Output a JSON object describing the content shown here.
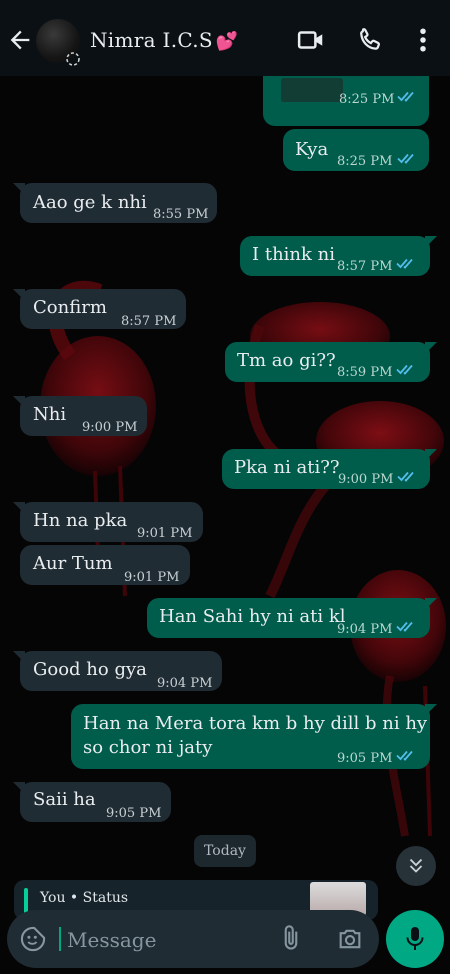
{
  "header": {
    "contact_name": "Nimra I.C.S",
    "contact_emoji": "💕",
    "icons": [
      "back-arrow-icon",
      "video-call-icon",
      "voice-call-icon",
      "more-options-icon"
    ]
  },
  "messages": [
    {
      "direction": "out",
      "text": "Kya",
      "time": "8:25 PM",
      "status": "read"
    },
    {
      "direction": "in",
      "text": "Aao ge k nhi",
      "time": "8:55 PM"
    },
    {
      "direction": "out",
      "text": "I think ni",
      "time": "8:57 PM",
      "status": "read"
    },
    {
      "direction": "in",
      "text": "Confirm",
      "time": "8:57 PM"
    },
    {
      "direction": "out",
      "text": "Tm ao gi??",
      "time": "8:59 PM",
      "status": "read"
    },
    {
      "direction": "in",
      "text": "Nhi",
      "time": "9:00 PM"
    },
    {
      "direction": "out",
      "text": "Pka ni ati??",
      "time": "9:00 PM",
      "status": "read"
    },
    {
      "direction": "in",
      "text": "Hn na pka",
      "time": "9:01 PM"
    },
    {
      "direction": "in",
      "text": "Aur Tum",
      "time": "9:01 PM"
    },
    {
      "direction": "out",
      "text": "Han Sahi hy ni ati kl",
      "time": "9:04 PM",
      "status": "read"
    },
    {
      "direction": "in",
      "text": "Good ho gya",
      "time": "9:04 PM"
    },
    {
      "direction": "out",
      "text_line1": "Han na Mera tora km b hy dill b ni hy",
      "text_line2": "so chor ni jaty",
      "time": "9:05 PM",
      "status": "read"
    },
    {
      "direction": "in",
      "text": "Saii ha",
      "time": "9:05 PM"
    }
  ],
  "top_partial_message": {
    "time": "8:25 PM",
    "status": "read"
  },
  "date_divider": "Today",
  "status_reply": {
    "label": "You • Status"
  },
  "composer": {
    "placeholder": "Message"
  },
  "colors": {
    "incoming_bubble": "#202c33",
    "outgoing_bubble": "#005c4b",
    "read_ticks": "#53bdeb",
    "accent": "#00a884"
  }
}
